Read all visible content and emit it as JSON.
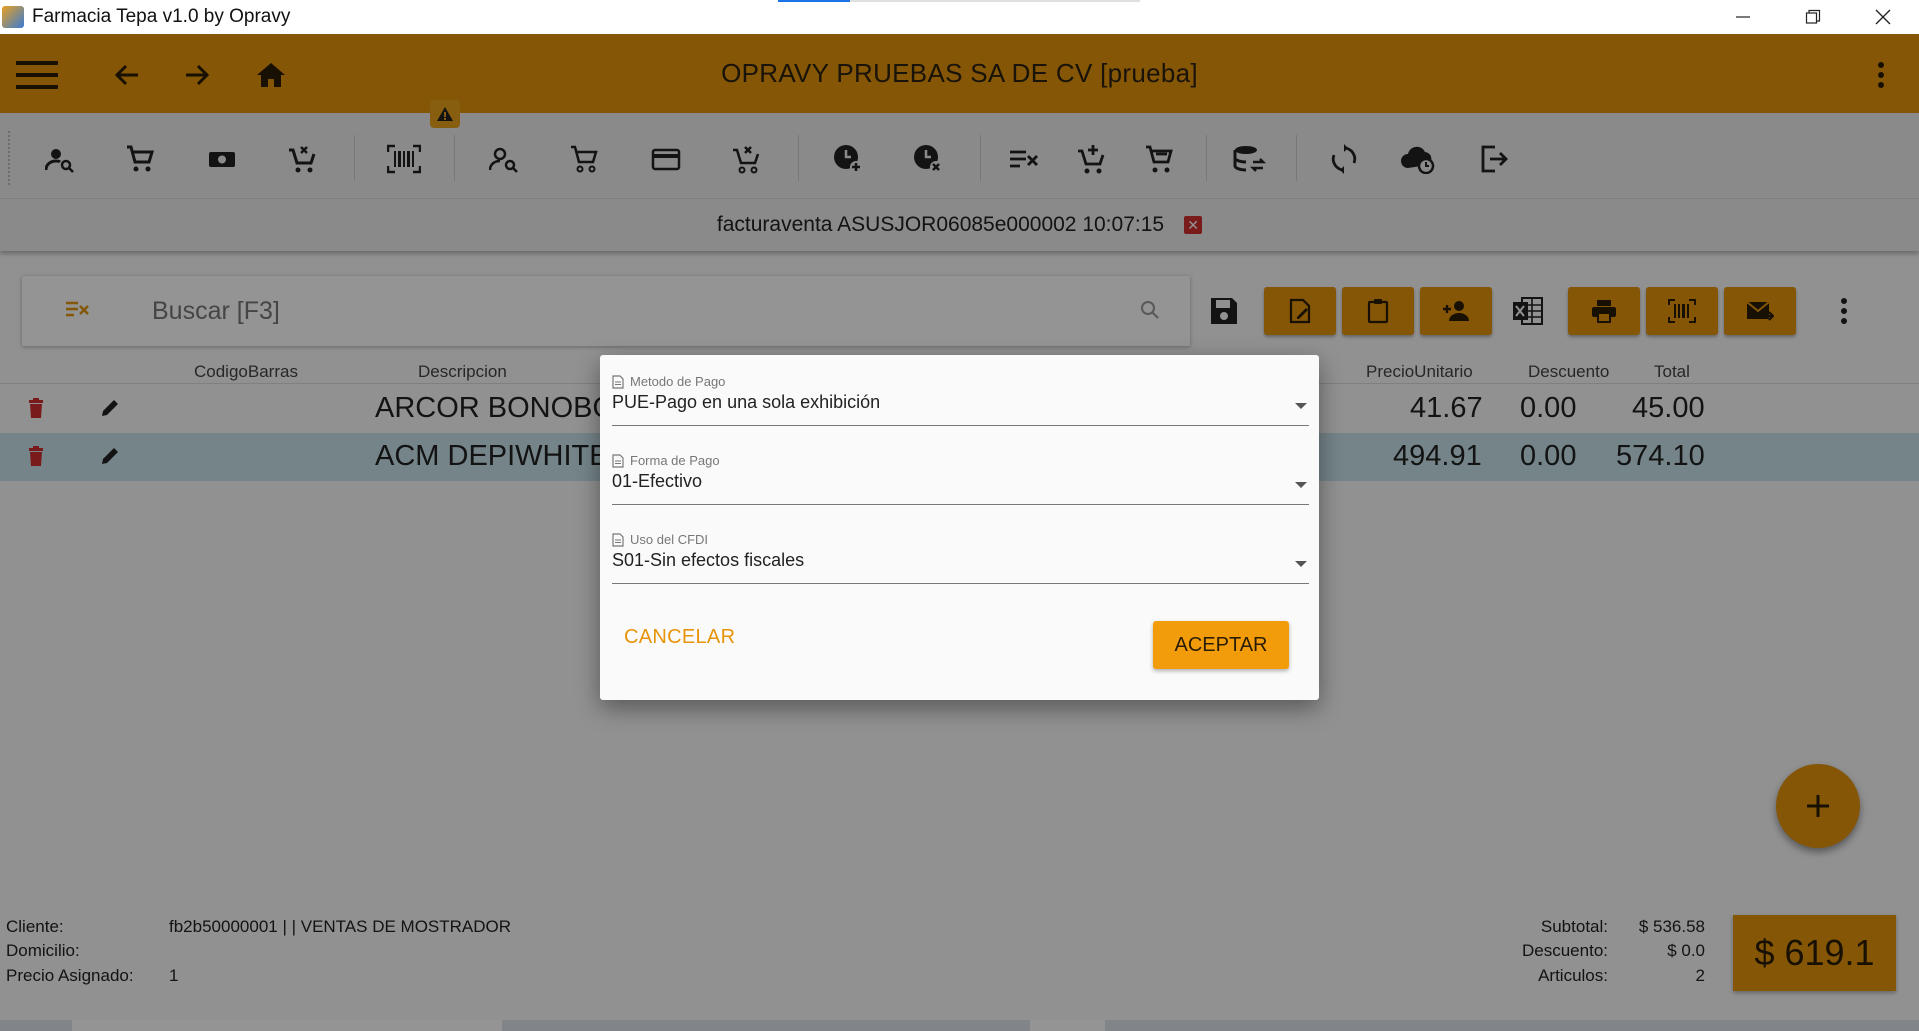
{
  "window": {
    "title": "Farmacia Tepa v1.0 by Opravy",
    "icons": [
      "app-icon",
      "minimize-icon",
      "restore-icon",
      "close-icon"
    ]
  },
  "header": {
    "company": "OPRAVY PRUEBAS SA DE CV [prueba]",
    "icons": [
      "menu-icon",
      "back-arrow-icon",
      "forward-arrow-icon",
      "home-icon",
      "more-vert-icon"
    ]
  },
  "toolbar": {
    "icons": [
      "person-search-icon",
      "cart-icon",
      "cash-icon",
      "cart-remove-icon",
      "barcode-scan-icon",
      "person-search-icon",
      "cart-outline-icon",
      "credit-card-icon",
      "cart-remove-icon",
      "clock-add-icon",
      "clock-cancel-icon",
      "clear-list-icon",
      "cart-add-icon",
      "cart-check-icon",
      "database-sync-icon",
      "sync-icon",
      "cloud-sync-icon",
      "logout-icon"
    ],
    "warning_icon": "warning-icon"
  },
  "document": {
    "text": "facturaventa ASUSJOR06085e000002 10:07:15",
    "close_glyph": "✕"
  },
  "search": {
    "placeholder": "Buscar [F3]"
  },
  "table": {
    "headers": {
      "barcode": "CodigoBarras",
      "description": "Descripcion",
      "unit_price": "PrecioUnitario",
      "discount": "Descuento",
      "total": "Total"
    },
    "rows": [
      {
        "description": "ARCOR BONOBO",
        "unit_price": "41.67",
        "discount": "0.00",
        "total": "45.00",
        "selected": false
      },
      {
        "description": "ACM DEPIWHITE",
        "unit_price": "494.91",
        "discount": "0.00",
        "total": "574.10",
        "selected": true
      }
    ]
  },
  "dialog": {
    "metodo_label": "Metodo de Pago",
    "metodo_value": "PUE-Pago en una sola exhibición",
    "forma_label": "Forma de Pago",
    "forma_value": "01-Efectivo",
    "uso_label": "Uso del CFDI",
    "uso_value": "S01-Sin efectos fiscales",
    "cancel": "CANCELAR",
    "accept": "ACEPTAR"
  },
  "footer": {
    "cliente_label": "Cliente:",
    "cliente_value": "fb2b50000001 | | VENTAS DE MOSTRADOR",
    "domicilio_label": "Domicilio:",
    "domicilio_value": "",
    "precio_label": "Precio Asignado:",
    "precio_value": "1",
    "subtotal_label": "Subtotal:",
    "subtotal_value": "$ 536.58",
    "descuento_label": "Descuento:",
    "descuento_value": "$ 0.0",
    "articulos_label": "Articulos:",
    "articulos_value": "2",
    "total": "$ 619.1"
  },
  "colors": {
    "accent": "#e3940b",
    "accept_button": "#f39c0b",
    "selected_row": "#c8e3ec",
    "delete": "#d32f2f"
  }
}
